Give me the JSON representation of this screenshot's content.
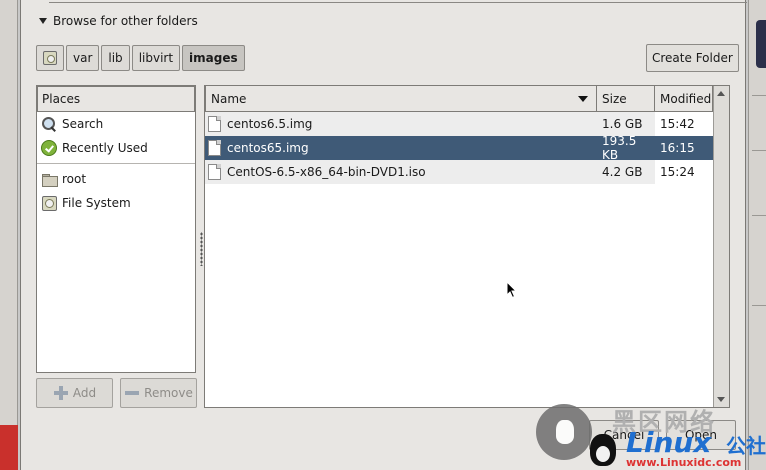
{
  "dialog": {
    "expander_label": "Browse for other folders",
    "path_segments": [
      {
        "label": "",
        "icon": "filesystem-icon"
      },
      {
        "label": "var"
      },
      {
        "label": "lib"
      },
      {
        "label": "libvirt"
      },
      {
        "label": "images",
        "active": true
      }
    ],
    "create_folder_label": "Create Folder"
  },
  "places": {
    "header": "Places",
    "items": [
      {
        "label": "Search",
        "icon": "search-icon"
      },
      {
        "label": "Recently Used",
        "icon": "recently-used-icon"
      },
      {
        "label": "root",
        "icon": "folder-icon"
      },
      {
        "label": "File System",
        "icon": "filesystem-icon"
      }
    ],
    "add_label": "Add",
    "remove_label": "Remove"
  },
  "files": {
    "columns": {
      "name": "Name",
      "size": "Size",
      "modified": "Modified"
    },
    "rows": [
      {
        "name": "centos6.5.img",
        "size": "1.6 GB",
        "modified": "15:42",
        "selected": false
      },
      {
        "name": "centos65.img",
        "size": "193.5 KB",
        "modified": "16:15",
        "selected": true
      },
      {
        "name": "CentOS-6.5-x86_64-bin-DVD1.iso",
        "size": "4.2 GB",
        "modified": "15:24",
        "selected": false
      }
    ]
  },
  "bottom_buttons": {
    "cancel_label": "Cancel",
    "open_label": "Open"
  },
  "watermark": {
    "cn": "黑区网络",
    "brand": "Linux",
    "brand_suffix": "公社",
    "url": "www.Linuxidc.com"
  },
  "colors": {
    "selection": "#3f5a77",
    "dialog_bg": "#e8e6e3",
    "brand_blue": "#1f6fd0"
  }
}
